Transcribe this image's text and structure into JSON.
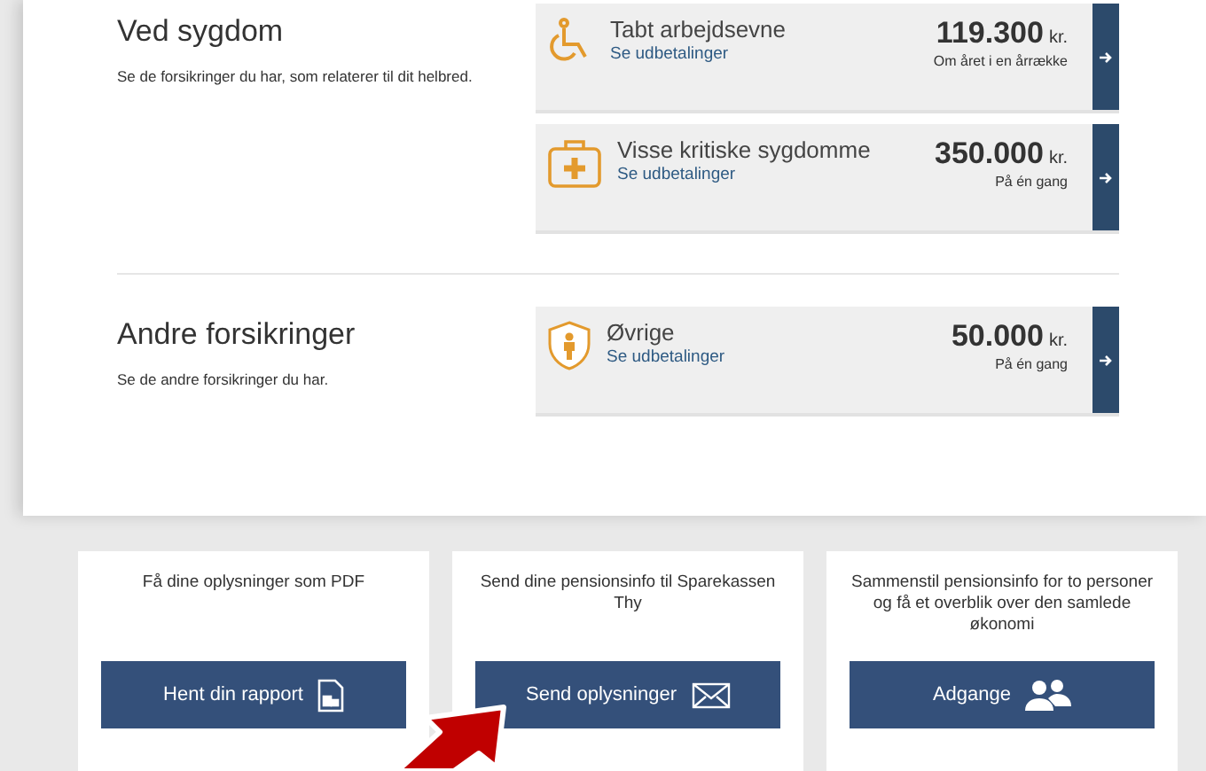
{
  "sections": [
    {
      "title": "Ved sygdom",
      "description": "Se de forsikringer du har, som relaterer til dit helbred.",
      "items": [
        {
          "kind": "wheelchair",
          "name": "Tabt arbejdsevne",
          "link": "Se udbetalinger",
          "amount": "119.300",
          "unit": "kr.",
          "note": "Om året i en årrække"
        },
        {
          "kind": "medkit",
          "name": "Visse kritiske sygdomme",
          "link": "Se udbetalinger",
          "amount": "350.000",
          "unit": "kr.",
          "note": "På én gang"
        }
      ]
    },
    {
      "title": "Andre forsikringer",
      "description": "Se de andre forsikringer du har.",
      "items": [
        {
          "kind": "shield",
          "name": "Øvrige",
          "link": "Se udbetalinger",
          "amount": "50.000",
          "unit": "kr.",
          "note": "På én gang"
        }
      ]
    }
  ],
  "actions": [
    {
      "kind": "document",
      "text": "Få dine oplysninger som PDF",
      "button": "Hent din rapport"
    },
    {
      "kind": "mail",
      "text": "Send dine pensionsinfo til Sparekassen Thy",
      "button": "Send oplysninger"
    },
    {
      "kind": "people",
      "text": "Sammenstil pensionsinfo for to personer og få et overblik over den samlede økonomi",
      "button": "Adgange"
    }
  ]
}
